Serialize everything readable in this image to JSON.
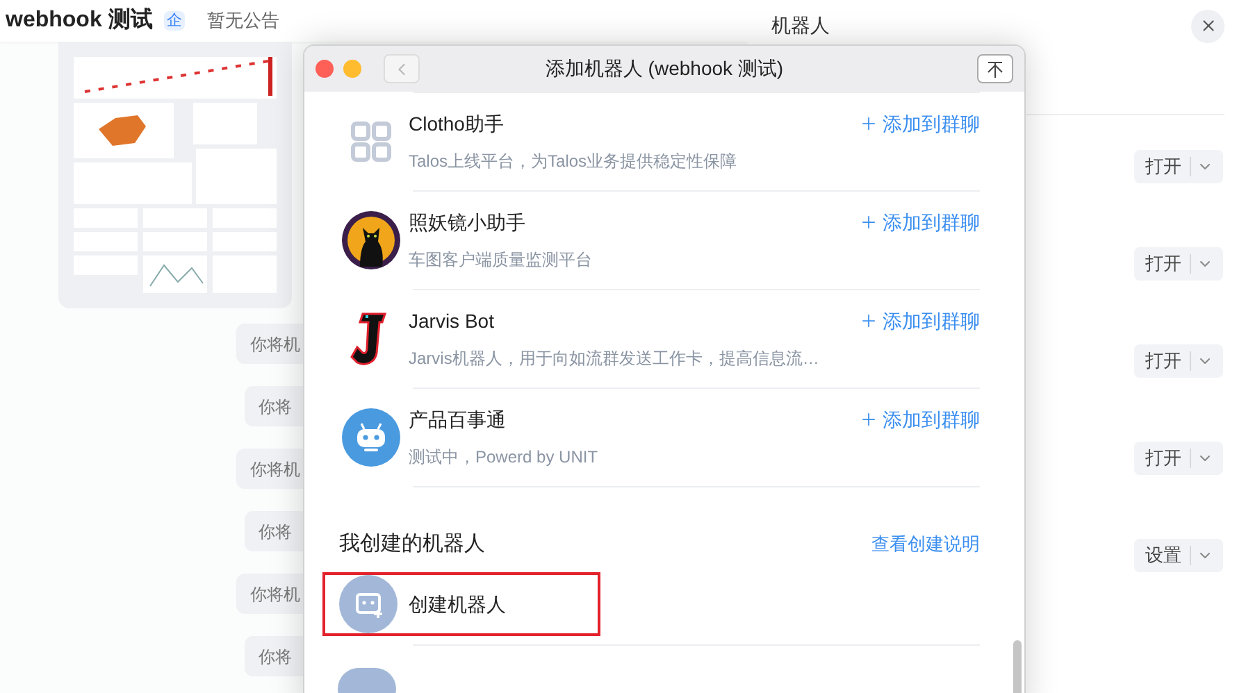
{
  "header": {
    "title": "webhook 测试",
    "badge": "企",
    "notice": "暂无公告"
  },
  "chat": {
    "bubbles": [
      {
        "text": "你将机"
      },
      {
        "text": "你将"
      },
      {
        "text": "你将机"
      },
      {
        "text": "你将"
      },
      {
        "text": "你将机"
      },
      {
        "text": "你将"
      }
    ]
  },
  "right_panel": {
    "title": "机器人",
    "actions": [
      {
        "label": "打开"
      },
      {
        "label": "打开"
      },
      {
        "label": "打开"
      },
      {
        "label": "打开"
      },
      {
        "label": "设置"
      }
    ]
  },
  "dialog": {
    "title": "添加机器人 (webhook 测试)",
    "robots": [
      {
        "kind": "grid",
        "name": "Clotho助手",
        "description": "Talos上线平台，为Talos业务提供稳定性保障",
        "action": "添加到群聊"
      },
      {
        "kind": "cat",
        "name": "照妖镜小助手",
        "description": "车图客户端质量监测平台",
        "action": "添加到群聊"
      },
      {
        "kind": "letter-j",
        "name": "Jarvis Bot",
        "description": "Jarvis机器人，用于向如流群发送工作卡，提高信息流…",
        "action": "添加到群聊"
      },
      {
        "kind": "robot",
        "name": "产品百事通",
        "description": "测试中，Powerd by UNIT",
        "action": "添加到群聊"
      }
    ],
    "my_section": {
      "title": "我创建的机器人",
      "link": "查看创建说明",
      "create_label": "创建机器人",
      "highlighted": true
    }
  }
}
